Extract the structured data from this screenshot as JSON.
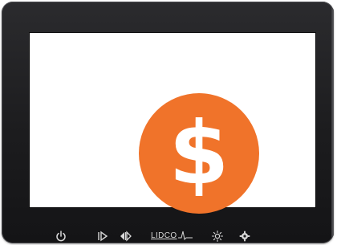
{
  "screen": {
    "background": "#ffffff",
    "coin": {
      "symbol": "$",
      "fill_color": "#f0732a",
      "symbol_color": "#ffffff"
    }
  },
  "bezel": {
    "color": "#1f1f21",
    "brand": "LIDCO"
  },
  "buttons": [
    {
      "icon": "power-icon"
    },
    {
      "icon": "input-source-icon"
    },
    {
      "icon": "menu-icon"
    },
    {
      "icon": "brightness-icon"
    },
    {
      "icon": "settings-icon"
    }
  ]
}
